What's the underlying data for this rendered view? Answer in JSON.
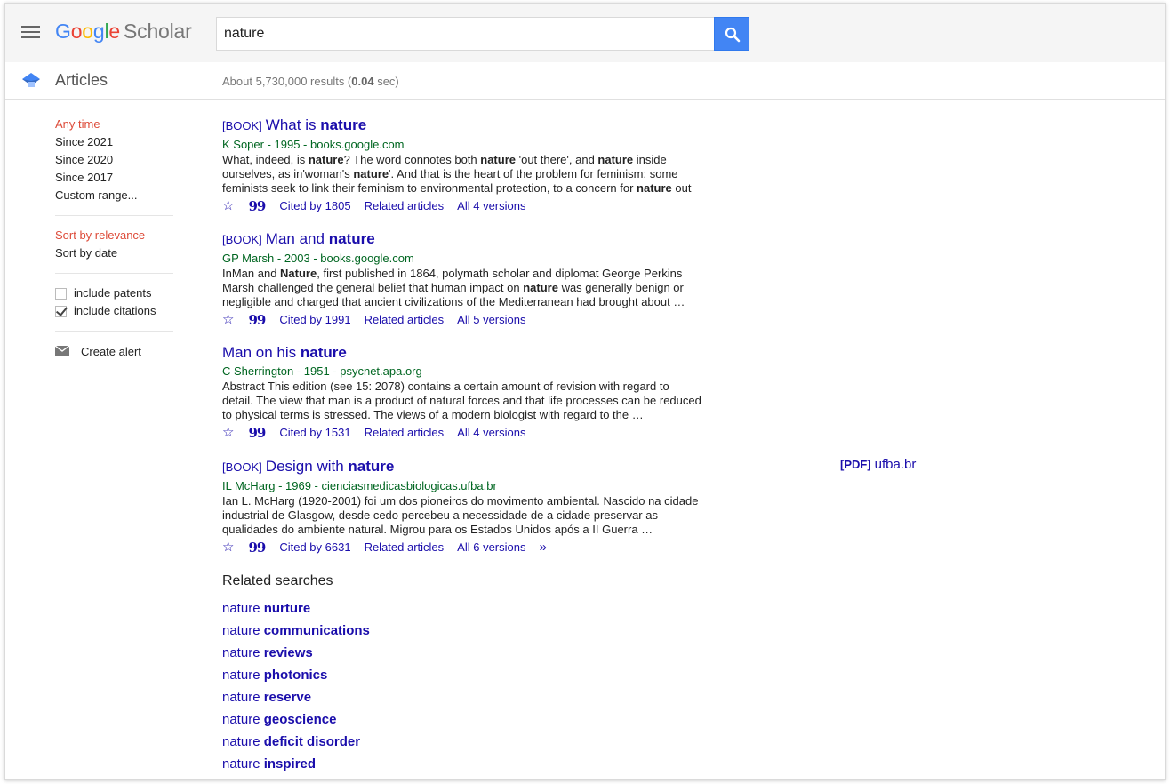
{
  "header": {
    "logo": {
      "google": [
        "G",
        "o",
        "o",
        "g",
        "l",
        "e"
      ],
      "product": "Scholar"
    },
    "search": {
      "value": "nature",
      "placeholder": ""
    }
  },
  "subbar": {
    "section": "Articles",
    "results_prefix": "About 5,730,000 results (",
    "results_time": "0.04",
    "results_suffix": " sec)"
  },
  "sidebar": {
    "time_filters": [
      "Any time",
      "Since 2021",
      "Since 2020",
      "Since 2017",
      "Custom range..."
    ],
    "active_time": "Any time",
    "sort": [
      "Sort by relevance",
      "Sort by date"
    ],
    "checks": [
      {
        "label": "include patents",
        "checked": false
      },
      {
        "label": "include citations",
        "checked": true
      }
    ],
    "alert": "Create alert"
  },
  "results": [
    {
      "type": "[BOOK]",
      "title_pre": "What is ",
      "title_bold": "nature",
      "meta": "K Soper - 1995 - books.google.com",
      "snippet_html": "What, indeed, is <b>nature</b>? The word connotes both <b>nature</b> 'out there', and <b>nature</b> inside ourselves, as in'woman's <b>nature</b>'. And that is the heart of the problem for feminism: some feminists seek to link their feminism to environmental protection, to a concern for <b>nature</b> out …",
      "cited": "Cited by 1805",
      "related": "Related articles",
      "versions": "All 4 versions",
      "side_tag": "",
      "side_site": ""
    },
    {
      "type": "[BOOK]",
      "title_pre": "Man and ",
      "title_bold": "nature",
      "meta": "GP Marsh - 2003 - books.google.com",
      "snippet_html": "InMan and <b>Nature</b>, first published in 1864, polymath scholar and diplomat George Perkins Marsh challenged the general belief that human impact on <b>nature</b> was generally benign or negligible and charged that ancient civilizations of the Mediterranean had brought about …",
      "cited": "Cited by 1991",
      "related": "Related articles",
      "versions": "All 5 versions",
      "side_tag": "",
      "side_site": ""
    },
    {
      "type": "",
      "title_pre": "Man on his ",
      "title_bold": "nature",
      "meta": "C Sherrington - 1951 - psycnet.apa.org",
      "snippet_html": "Abstract This edition (see 15: 2078) contains a certain amount of revision with regard to detail. The view that man is a product of natural forces and that life processes can be reduced to physical terms is stressed. The views of a modern biologist with regard to the …",
      "cited": "Cited by 1531",
      "related": "Related articles",
      "versions": "All 4 versions",
      "side_tag": "",
      "side_site": ""
    },
    {
      "type": "[BOOK]",
      "title_pre": "Design with ",
      "title_bold": "nature",
      "meta": "IL McHarg - 1969 - cienciasmedicasbiologicas.ufba.br",
      "snippet_html": "Ian L. McHarg (1920-2001) foi um dos pioneiros do movimento ambiental. Nascido na cidade industrial de Glasgow, desde cedo percebeu a necessidade de a cidade preservar as qualidades do ambiente natural. Migrou para os Estados Unidos após a II Guerra …",
      "cited": "Cited by 6631",
      "related": "Related articles",
      "versions": "All 6 versions",
      "side_tag": "[PDF]",
      "side_site": "ufba.br"
    }
  ],
  "related_searches": {
    "title": "Related searches",
    "items": [
      {
        "pre": "nature ",
        "bold": "nurture"
      },
      {
        "pre": "nature ",
        "bold": "communications"
      },
      {
        "pre": "nature ",
        "bold": "reviews"
      },
      {
        "pre": "nature ",
        "bold": "photonics"
      },
      {
        "pre": "nature ",
        "bold": "reserve"
      },
      {
        "pre": "nature ",
        "bold": "geoscience"
      },
      {
        "pre": "nature ",
        "bold": "deficit disorder"
      },
      {
        "pre": "nature ",
        "bold": "inspired"
      }
    ]
  },
  "icons": {
    "menu": "hamburger-icon",
    "search": "magnifier-icon",
    "articles": "scholar-cap-icon",
    "mail": "mail-icon",
    "star": "star-icon",
    "cite": "quote-icon",
    "more": "double-chevron-icon"
  },
  "colors": {
    "link": "#1a0dab",
    "active_filter": "#dd4b39",
    "meta_green": "#006621",
    "search_button": "#4285f4"
  }
}
